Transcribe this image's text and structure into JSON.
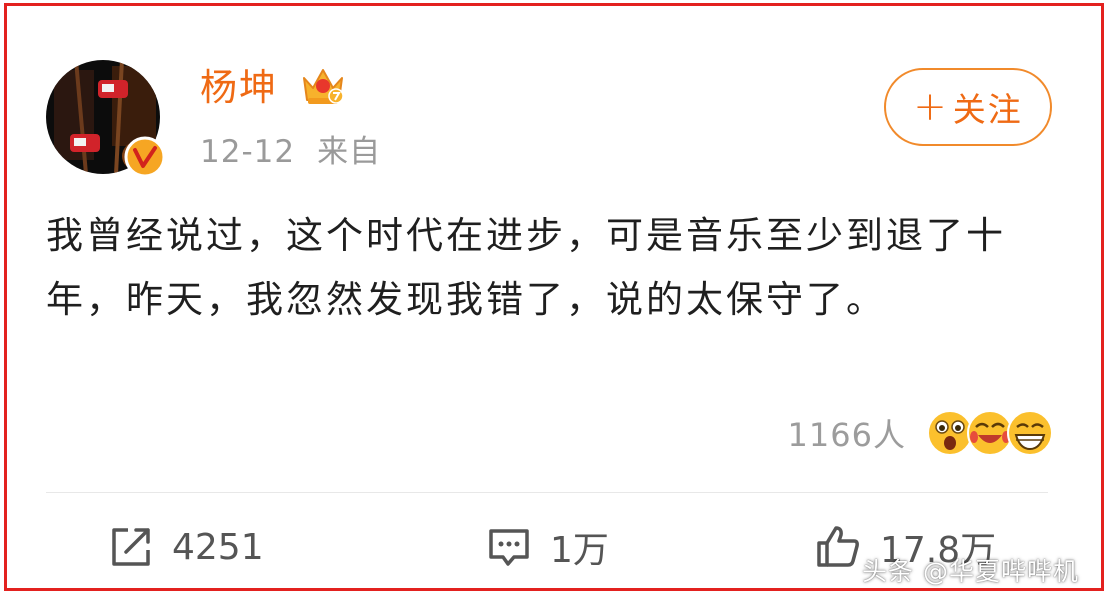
{
  "user": {
    "name": "杨坤",
    "date": "12-12",
    "source": "来自"
  },
  "follow_button": {
    "label": "关注"
  },
  "post": {
    "text": "我曾经说过，这个时代在进步，可是音乐至少到退了十年，昨天，我忽然发现我错了，说的太保守了。"
  },
  "reactions": {
    "count": "1166人",
    "emojis": [
      "shocked-face-icon",
      "laughing-tears-face-icon",
      "grinning-face-icon"
    ]
  },
  "actions": {
    "repost_count": "4251",
    "comment_count": "1万",
    "like_count": "17.8万"
  },
  "watermark": "头条 @华夏哔哔机",
  "colors": {
    "accent": "#ef6a14",
    "frame": "#e3211f",
    "muted": "#9a9a9a",
    "text": "#1f1f1f"
  }
}
